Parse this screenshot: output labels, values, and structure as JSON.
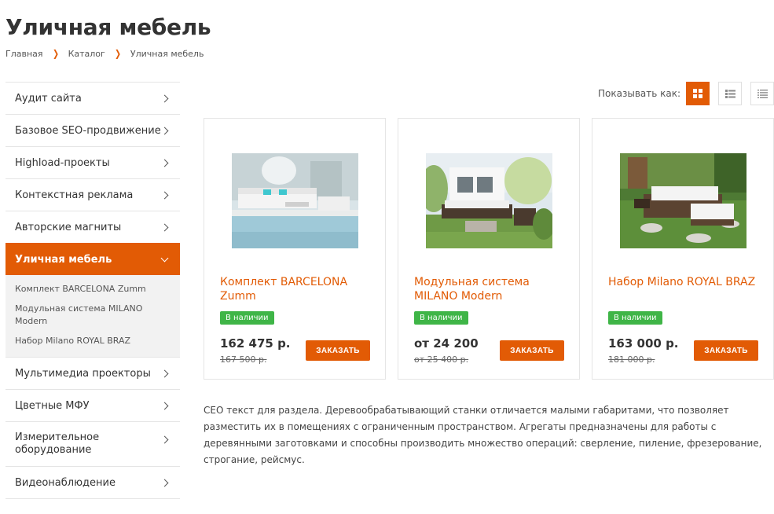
{
  "page": {
    "title": "Уличная мебель"
  },
  "breadcrumb": [
    "Главная",
    "Каталог",
    "Уличная мебель"
  ],
  "sidebar": {
    "items": [
      {
        "label": "Аудит сайта"
      },
      {
        "label": "Базовое SEO-продвижение"
      },
      {
        "label": "Highload-проекты"
      },
      {
        "label": "Контекстная реклама"
      },
      {
        "label": "Авторские магниты"
      },
      {
        "label": "Уличная мебель"
      },
      {
        "label": "Мультимедиа проекторы"
      },
      {
        "label": "Цветные МФУ"
      },
      {
        "label": "Измерительное оборудование"
      },
      {
        "label": "Видеонаблюдение"
      }
    ],
    "subitems": [
      {
        "label": "Комплект BARCELONA Zumm"
      },
      {
        "label": "Модульная система MILANO Modern"
      },
      {
        "label": "Набор Milano ROYAL BRAZ"
      }
    ]
  },
  "view": {
    "label": "Показывать как:"
  },
  "products": [
    {
      "name": "Комплект BARCELONA Zumm",
      "badge": "В наличии",
      "price": "162 475 р.",
      "old_price": "167 500 р.",
      "button": "ЗАКАЗАТЬ"
    },
    {
      "name": "Модульная система MILANO Modern",
      "badge": "В наличии",
      "price": "от 24 200",
      "old_price": "от 25 400 р.",
      "button": "ЗАКАЗАТЬ"
    },
    {
      "name": "Набор Milano ROYAL BRAZ",
      "badge": "В наличии",
      "price": "163 000 р.",
      "old_price": "181 000 р.",
      "button": "ЗАКАЗАТЬ"
    }
  ],
  "seo_text": "СЕО текст для раздела. Деревообрабатывающий станки отличается малыми габаритами, что позволяет разместить их в помещениях с ограниченным пространством. Агрегаты предназначены для работы с деревянными заготовками и способны производить множество операций: сверление, пиление, фрезерование, строгание, рейсмус.",
  "colors": {
    "accent": "#e25b05",
    "in_stock": "#3fb547",
    "text": "#333333",
    "border": "#e5e5e5"
  },
  "icons": {
    "breadcrumb_separator": "chevron-right-icon",
    "menu_arrow": "chevron-right-icon",
    "active_arrow": "chevron-down-icon",
    "view_modes": [
      "grid-view-icon",
      "list-view-icon",
      "table-view-icon"
    ]
  }
}
